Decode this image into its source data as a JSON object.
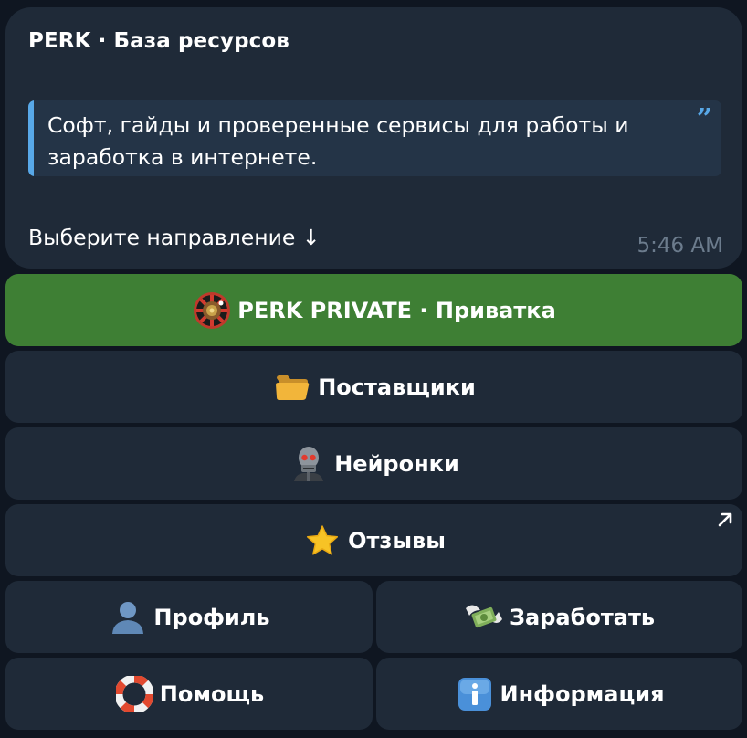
{
  "message": {
    "sender": "PERK · База ресурсов",
    "quote": "Софт, гайды и проверенные сервисы для работы и заработка в интернете.",
    "quote_icon": "quote-marks-icon",
    "prompt": "Выберите направление ↓",
    "time": "5:46 AM"
  },
  "keyboard": {
    "private": {
      "label": "PERK PRIVATE · Приватка",
      "icon": "roulette-wheel-icon"
    },
    "suppliers": {
      "label": "Поставщики",
      "icon": "folder-icon"
    },
    "neural": {
      "label": "Нейронки",
      "icon": "skull-robot-icon"
    },
    "reviews": {
      "label": "Отзывы",
      "icon": "star-icon",
      "link_icon": "external-arrow-icon"
    },
    "profile": {
      "label": "Профиль",
      "icon": "user-silhouette-icon"
    },
    "earn": {
      "label": "Заработать",
      "icon": "money-wings-icon"
    },
    "help": {
      "label": "Помощь",
      "icon": "lifebuoy-icon"
    },
    "info": {
      "label": "Информация",
      "icon": "info-icon"
    }
  },
  "colors": {
    "background": "#0f1621",
    "bubble": "#1f2a38",
    "quote_bg": "#243447",
    "accent": "#58a8e8",
    "primary_button": "#3e7f34",
    "timestamp": "#6c7c8d"
  }
}
